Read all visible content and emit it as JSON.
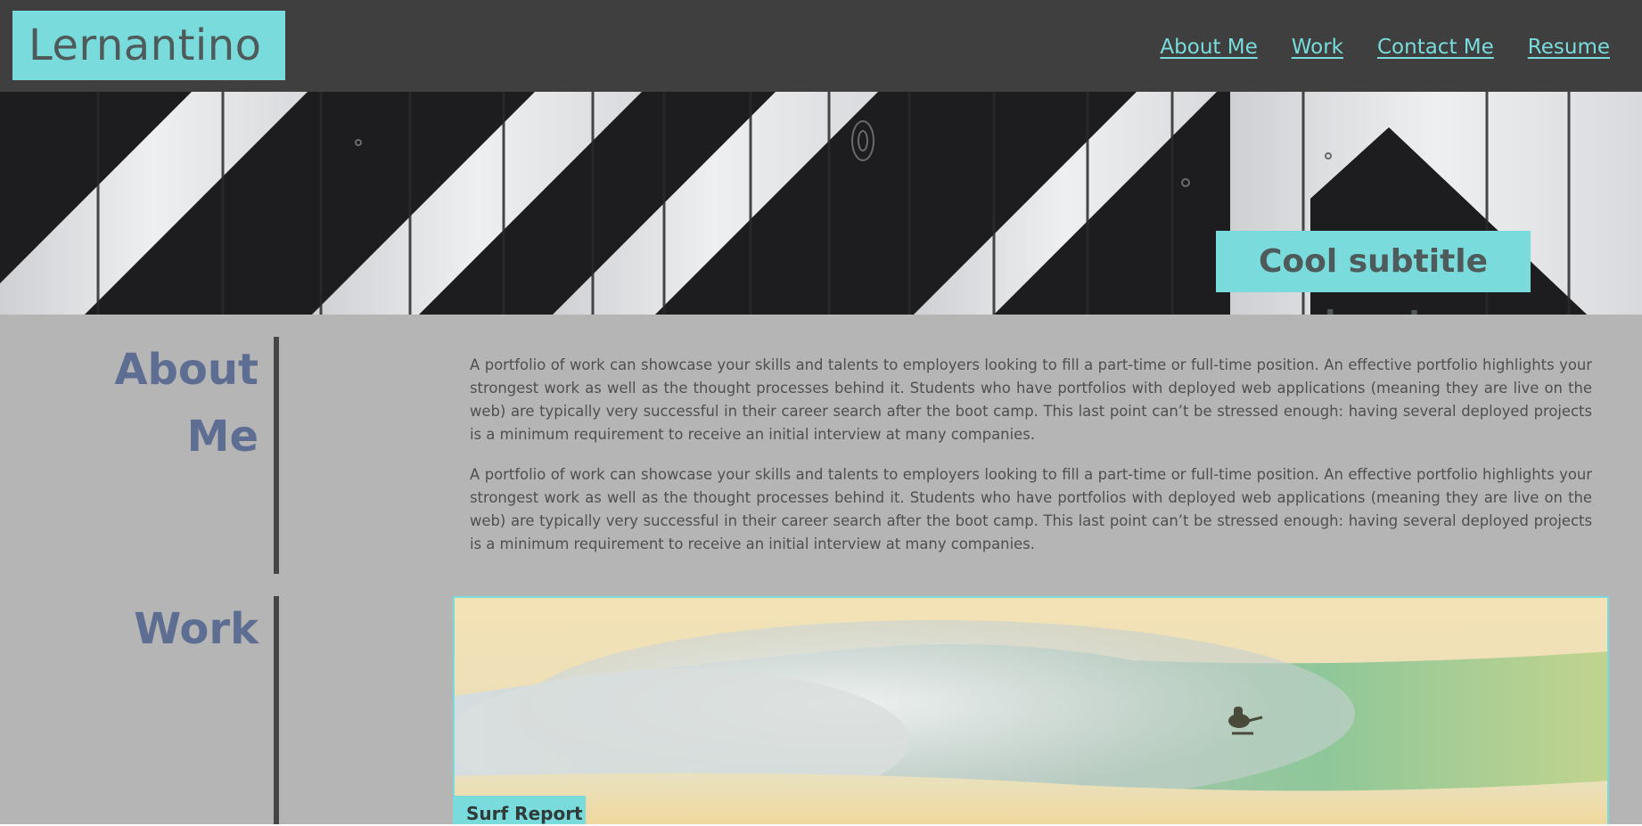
{
  "header": {
    "logo": "Lernantino",
    "nav": [
      {
        "label": "About Me"
      },
      {
        "label": "Work"
      },
      {
        "label": "Contact Me"
      },
      {
        "label": "Resume"
      }
    ]
  },
  "hero": {
    "subtitle": "Cool subtitle here!"
  },
  "about": {
    "title": "About Me",
    "paragraphs": [
      "A portfolio of work can showcase your skills and talents to employers looking to fill a part-time or full-time position. An effective portfolio highlights your strongest work as well as the thought processes behind it. Students who have portfolios with deployed web applications (meaning they are live on the web) are typically very successful in their career search after the boot camp. This last point can’t be stressed enough: having several deployed projects is a minimum requirement to receive an initial interview at many companies.",
      "A portfolio of work can showcase your skills and talents to employers looking to fill a part-time or full-time position. An effective portfolio highlights your strongest work as well as the thought processes behind it. Students who have portfolios with deployed web applications (meaning they are live on the web) are typically very successful in their career search after the boot camp. This last point can’t be stressed enough: having several deployed projects is a minimum requirement to receive an initial interview at many companies."
    ]
  },
  "work": {
    "title": "Work",
    "projects": [
      {
        "label": "Surf Report"
      }
    ]
  },
  "colors": {
    "accent": "#79dbdb",
    "header_bg": "#3f3f3f",
    "page_bg": "#b5b5b5",
    "title": "#5e6e93"
  }
}
